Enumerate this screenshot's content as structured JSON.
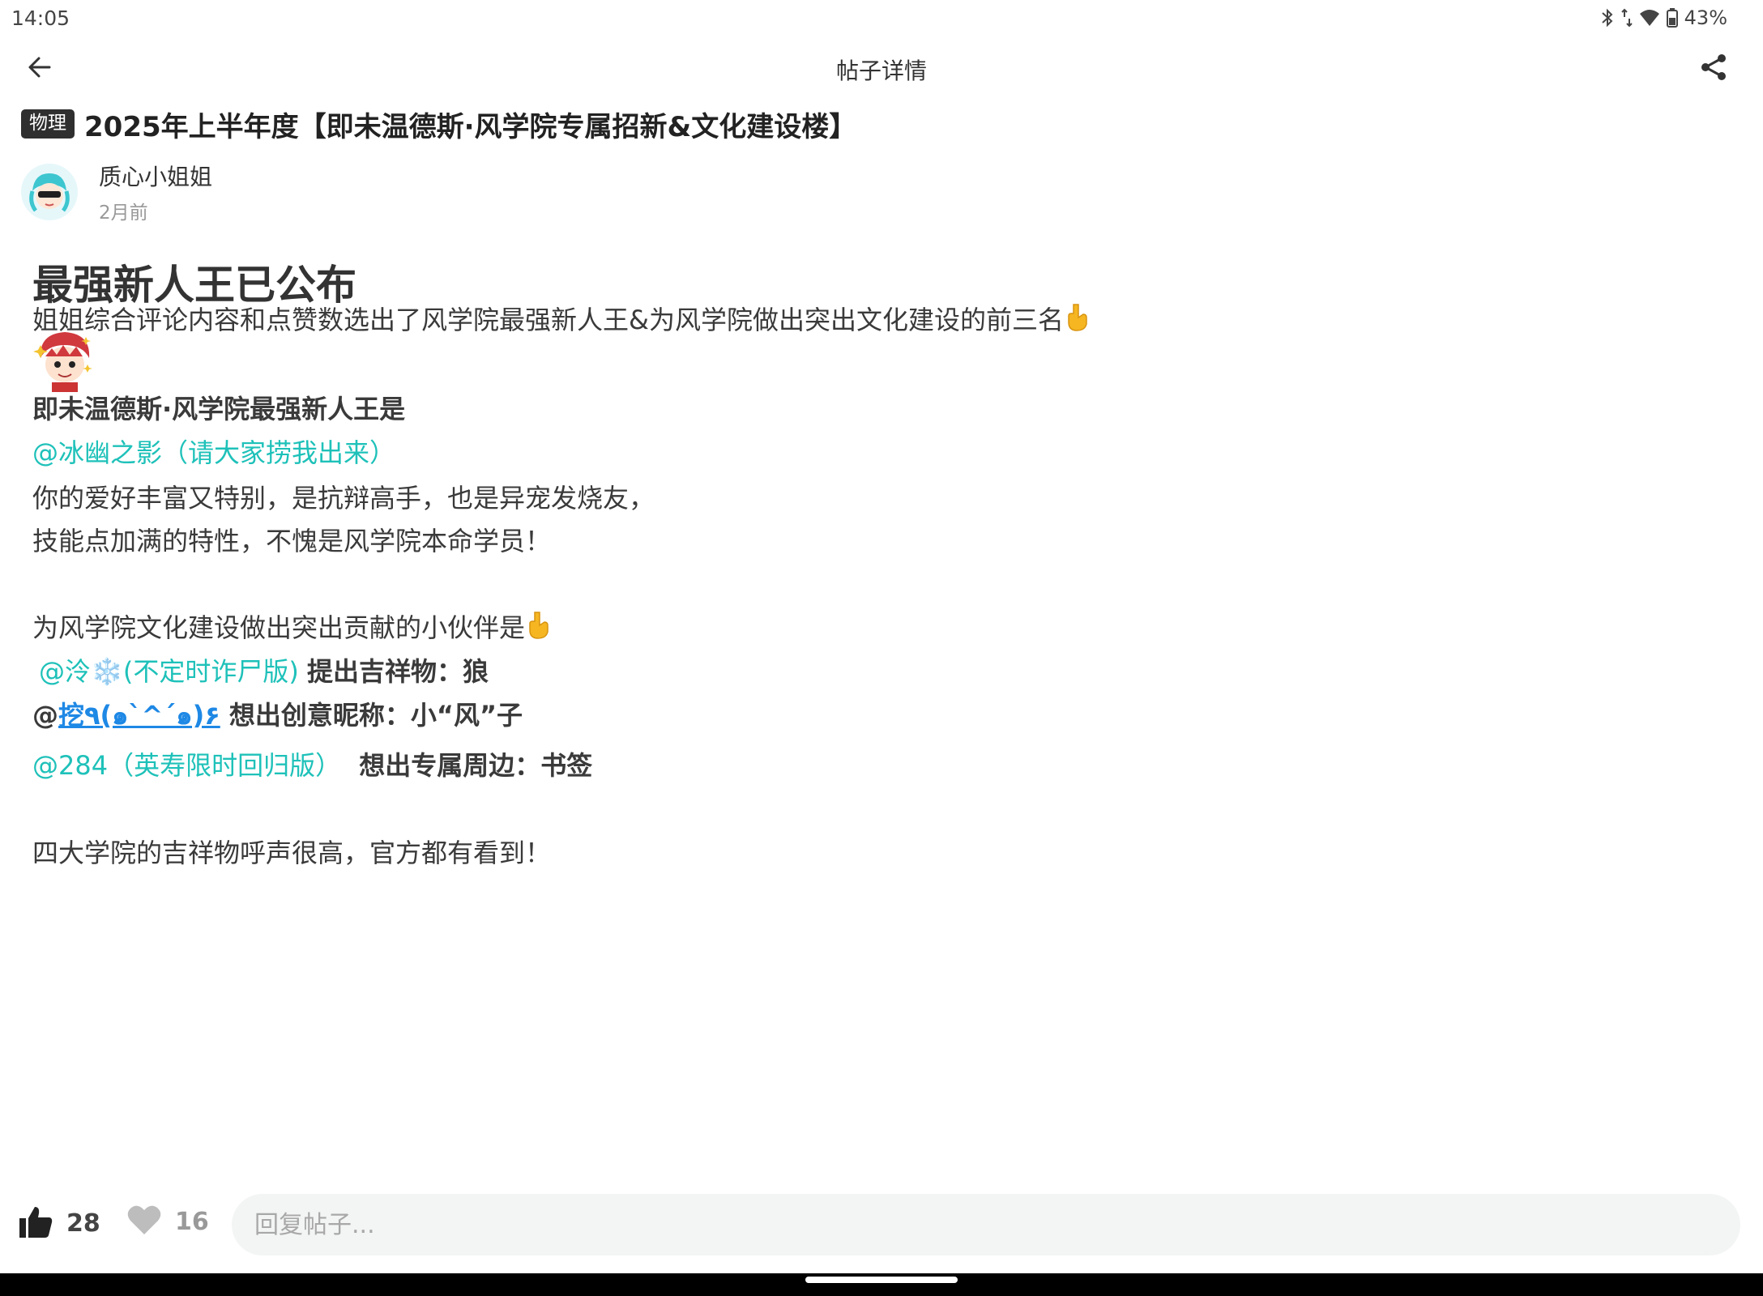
{
  "status_bar": {
    "time": "14:05",
    "battery": "43%",
    "icons": [
      "bluetooth-icon",
      "data-arrows-icon",
      "wifi-icon",
      "battery-icon"
    ]
  },
  "header": {
    "title": "帖子详情",
    "back_icon": "back-arrow-icon",
    "share_icon": "share-icon"
  },
  "post": {
    "category": "物理",
    "title": "2025年上半年度【即未温德斯·风学院专属招新&文化建设楼】",
    "author": "质心小姐姐",
    "time": "2月前"
  },
  "content": {
    "heading": "最强新人王已公布",
    "para1": "姐姐综合评论内容和点赞数选出了风学院最强新人王&为风学院做出突出文化建设的前三名",
    "section1_title": "即未温德斯·风学院最强新人王是",
    "winner_mention": "@冰幽之影（请大家捞我出来）",
    "winner_line1": "你的爱好丰富又特别，是抗辩高手，也是异宠发烧友，",
    "winner_line2": "技能点加满的特性，不愧是风学院本命学员！",
    "section2_title": "为风学院文化建设做出突出贡献的小伙伴是",
    "contrib1_mention": "@泠❄️(不定时诈尸版)",
    "contrib1_text": "提出吉祥物：狼",
    "contrib2_at": "@",
    "contrib2_link": "挖٩(๑`^´๑)۶",
    "contrib2_text": "想出创意昵称：小“风”子",
    "contrib3_mention": "@284（英寿限时回归版）",
    "contrib3_text": "想出专属周边：书签",
    "cut_line": "四大学院的吉祥物呼声很高，官方都有看到！"
  },
  "actions": {
    "like_count": "28",
    "fav_count": "16",
    "reply_placeholder": "回复帖子..."
  },
  "colors": {
    "mention": "#1ec1b9",
    "link": "#1e88e5",
    "badge_bg": "#2f2f2f"
  }
}
